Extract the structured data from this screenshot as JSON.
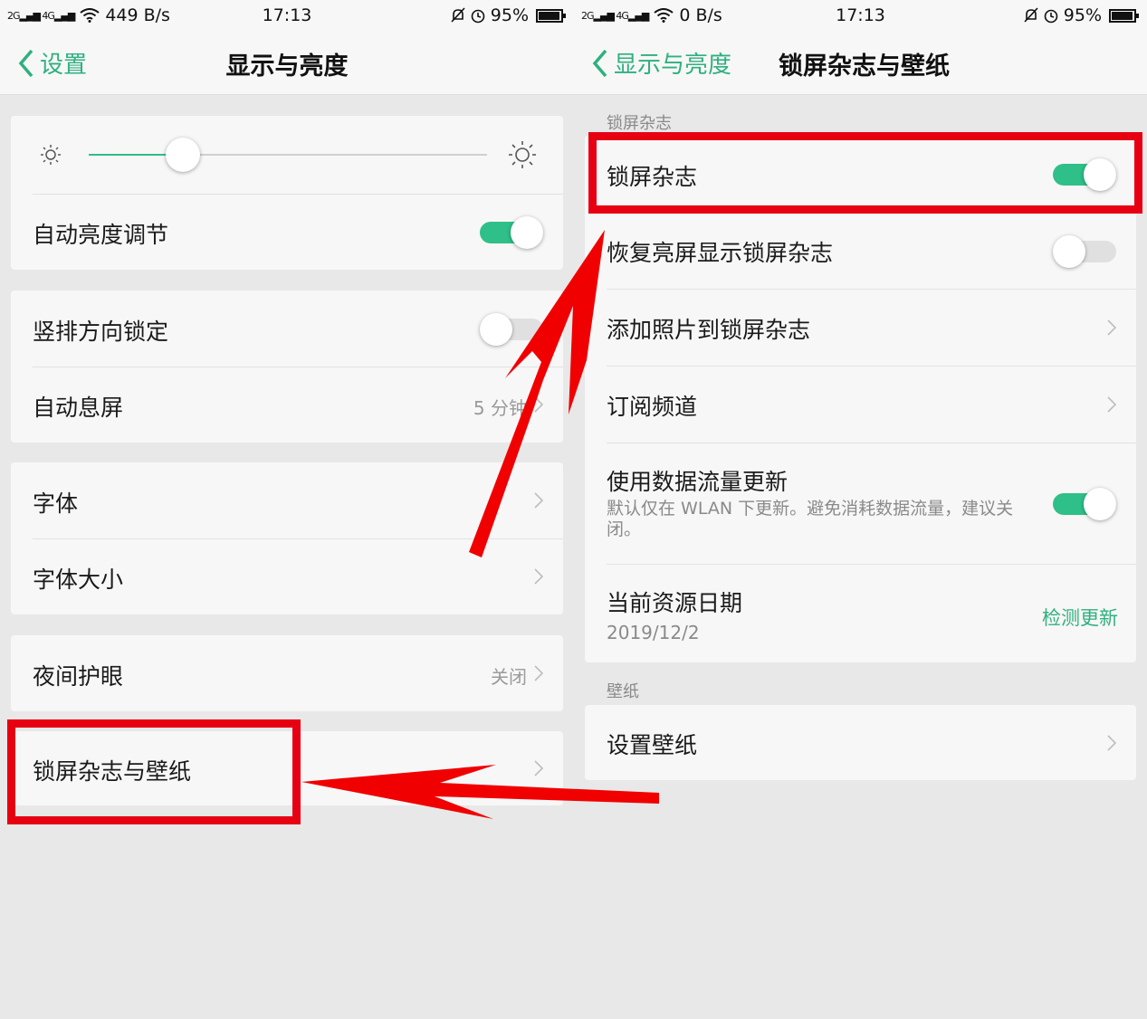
{
  "left": {
    "status": {
      "signal": "2G 4G 2G",
      "net_speed": "449 B/s",
      "time": "17:13",
      "battery": "95%"
    },
    "nav": {
      "back_label": "设置",
      "title": "显示与亮度"
    },
    "brightness": {
      "level": 0.21
    },
    "items": {
      "auto_brightness": "自动亮度调节",
      "portrait_lock": "竖排方向锁定",
      "auto_sleep": "自动息屏",
      "auto_sleep_value": "5 分钟",
      "font": "字体",
      "font_size": "字体大小",
      "night_mode": "夜间护眼",
      "night_mode_value": "关闭",
      "lockscreen": "锁屏杂志与壁纸"
    },
    "toggles": {
      "auto_brightness": true,
      "portrait_lock": false
    }
  },
  "right": {
    "status": {
      "signal": "2G 4G 2G",
      "net_speed": "0 B/s",
      "time": "17:13",
      "battery": "95%"
    },
    "nav": {
      "back_label": "显示与亮度",
      "title": "锁屏杂志与壁纸"
    },
    "section_magazine": "锁屏杂志",
    "section_wallpaper": "壁纸",
    "items": {
      "magazine": "锁屏杂志",
      "restore": "恢复亮屏显示锁屏杂志",
      "add_photo": "添加照片到锁屏杂志",
      "subscribe": "订阅频道",
      "data_update": "使用数据流量更新",
      "data_update_desc": "默认仅在 WLAN 下更新。避免消耗数据流量，建议关闭。",
      "source_date": "当前资源日期",
      "source_date_value": "2019/12/2",
      "check_update": "检测更新",
      "set_wallpaper": "设置壁纸"
    },
    "toggles": {
      "magazine": true,
      "restore": false,
      "data_update": true
    }
  },
  "colors": {
    "accent": "#2fbf88",
    "highlight": "#e60012",
    "background": "#e8e8e8",
    "card": "#f7f7f7"
  }
}
